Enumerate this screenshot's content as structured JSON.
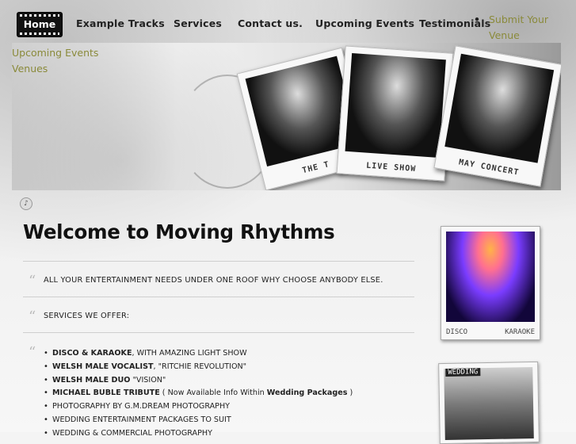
{
  "nav": {
    "home": "Home",
    "items": [
      "Example Tracks",
      "Services",
      "Contact us.",
      "Upcoming Events",
      "Testimonials"
    ],
    "dropdown": [
      "Submit Your",
      "Venue"
    ],
    "sub_links": [
      "Upcoming Events",
      "Venues"
    ]
  },
  "banner": {
    "captions": [
      "THE T",
      "LIVE SHOW",
      "MAY CONCERT"
    ]
  },
  "main": {
    "title": "Welcome to Moving Rhythms",
    "intro": "ALL YOUR ENTERTAINMENT NEEDS UNDER ONE ROOF WHY CHOOSE ANYBODY ELSE.",
    "services_heading": "SERVICES WE OFFER:",
    "services": [
      {
        "bold": "DISCO & KARAOKE",
        "rest": ", WITH AMAZING LIGHT SHOW"
      },
      {
        "bold": "WELSH MALE VOCALIST",
        "rest": ", \"RITCHIE REVOLUTION\""
      },
      {
        "bold": "WELSH MALE DUO",
        "rest": " \"VISION\""
      },
      {
        "bold": "MICHAEL BUBLE TRIBUTE",
        "rest": " ( Now Available Info Within ",
        "bold2": "Wedding Packages",
        "rest2": " )"
      },
      {
        "bold": "",
        "rest": "PHOTOGRAPHY BY G.M.DREAM PHOTOGRAPHY"
      },
      {
        "bold": "",
        "rest": "WEDDING ENTERTAINMENT PACKAGES TO SUIT"
      },
      {
        "bold": "",
        "rest": "WEDDING & COMMERCIAL PHOTOGRAPHY"
      }
    ]
  },
  "sidebar": {
    "photo1_captions": [
      "DISCO",
      "KARAOKE"
    ],
    "photo2_caption": "WEDDING"
  },
  "colors": {
    "accent": "#8a8a3a",
    "nav_active_bg": "#111111"
  }
}
